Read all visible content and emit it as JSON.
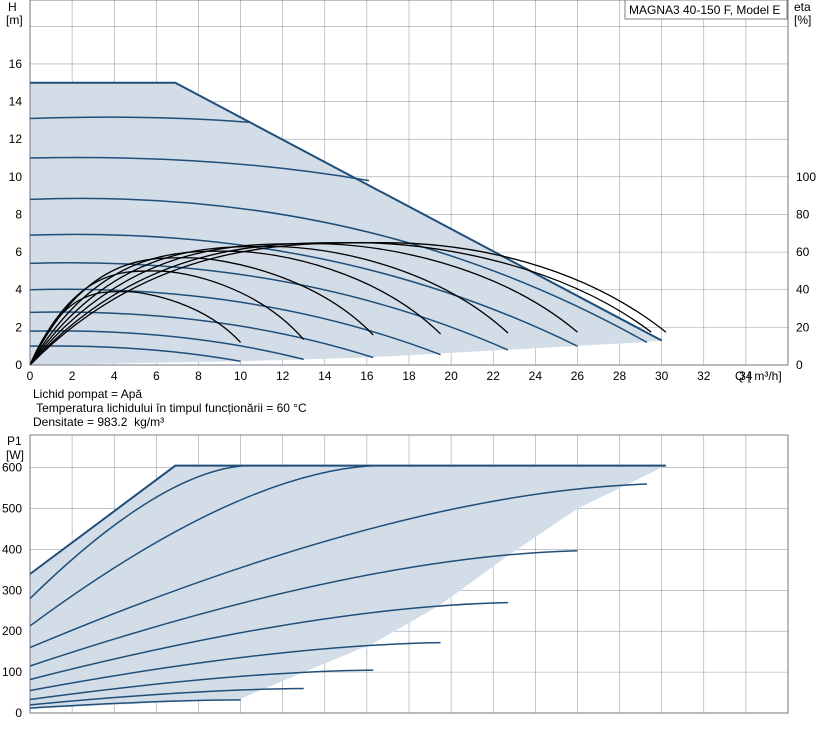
{
  "chart_data": [
    {
      "id": "hq",
      "type": "line",
      "title": "MAGNA3 40-150 F, Model E",
      "ylabel_line1": "H",
      "ylabel_line2": "[m]",
      "y2label_line1": "eta",
      "y2label_line2": "[%]",
      "xlabel": "Q [ m³/h]",
      "xlim": [
        0,
        36
      ],
      "ylim": [
        0,
        19.4
      ],
      "y2lim": [
        0,
        19.4
      ],
      "x_ticks": [
        0,
        2,
        4,
        6,
        8,
        10,
        12,
        14,
        16,
        18,
        20,
        22,
        24,
        26,
        28,
        30,
        32,
        34
      ],
      "y_ticks": [
        0,
        2,
        4,
        6,
        8,
        10,
        12,
        14,
        16
      ],
      "y2_ticks": [
        0,
        20,
        40,
        60,
        80,
        100
      ],
      "y2_scale_note": "eta 100% plotted at H=10 m",
      "grid": true,
      "notes": [
        "Lichid pompat = Apă",
        " Temperatura lichidului în timpul funcționării = 60 °C",
        "Densitate = 983.2  kg/m³"
      ],
      "operating_area_color": "#d3dde8",
      "curve_color": "#1f4e79",
      "eff_color": "#000000",
      "envelope": [
        [
          0,
          15
        ],
        [
          6.9,
          15
        ],
        [
          30,
          1.3
        ],
        [
          29,
          1.2
        ],
        [
          16,
          0.4
        ],
        [
          10,
          0.2
        ],
        [
          0,
          0
        ]
      ],
      "series": [
        {
          "values": [
            [
              0,
              1.0
            ],
            [
              10,
              0.2
            ]
          ]
        },
        {
          "values": [
            [
              0,
              1.8
            ],
            [
              13,
              0.3
            ]
          ]
        },
        {
          "values": [
            [
              0,
              2.8
            ],
            [
              16.3,
              0.4
            ]
          ]
        },
        {
          "values": [
            [
              0,
              4.0
            ],
            [
              19.5,
              0.55
            ]
          ]
        },
        {
          "values": [
            [
              0,
              5.4
            ],
            [
              22.7,
              0.8
            ]
          ]
        },
        {
          "values": [
            [
              0,
              6.9
            ],
            [
              26,
              1.0
            ]
          ]
        },
        {
          "values": [
            [
              0,
              8.8
            ],
            [
              29.3,
              1.2
            ]
          ]
        },
        {
          "values": [
            [
              0,
              11.0
            ],
            [
              16.1,
              9.8
            ]
          ]
        },
        {
          "values": [
            [
              0,
              13.1
            ],
            [
              10.4,
              12.9
            ]
          ]
        }
      ],
      "efficiency_series": [
        {
          "values": [
            [
              0,
              0
            ],
            [
              4.5,
              3.9
            ],
            [
              10,
              1.2
            ]
          ]
        },
        {
          "values": [
            [
              0,
              0
            ],
            [
              6,
              5.0
            ],
            [
              13,
              1.35
            ]
          ]
        },
        {
          "values": [
            [
              0,
              0
            ],
            [
              7.5,
              5.7
            ],
            [
              16.3,
              1.6
            ]
          ]
        },
        {
          "values": [
            [
              0,
              0
            ],
            [
              9.5,
              6.05
            ],
            [
              19.5,
              1.65
            ]
          ]
        },
        {
          "values": [
            [
              0,
              0
            ],
            [
              11.5,
              6.3
            ],
            [
              22.7,
              1.7
            ]
          ]
        },
        {
          "values": [
            [
              0,
              0
            ],
            [
              13.5,
              6.45
            ],
            [
              26,
              1.75
            ]
          ]
        },
        {
          "values": [
            [
              0,
              0
            ],
            [
              15.5,
              6.5
            ],
            [
              29.5,
              1.75
            ]
          ]
        },
        {
          "values": [
            [
              0,
              0
            ],
            [
              16.8,
              6.5
            ],
            [
              30.2,
              1.75
            ]
          ]
        }
      ]
    },
    {
      "id": "p1",
      "type": "line",
      "ylabel_line1": "P1",
      "ylabel_line2": "[W]",
      "xlim": [
        0,
        36
      ],
      "ylim": [
        0,
        680
      ],
      "y_ticks": [
        0,
        100,
        200,
        300,
        400,
        500,
        600
      ],
      "grid": true,
      "operating_area_color": "#d3dde8",
      "curve_color": "#1f4e79",
      "envelope": [
        [
          0,
          340
        ],
        [
          6.9,
          605
        ],
        [
          30.2,
          605
        ],
        [
          26,
          500
        ],
        [
          22.7,
          385
        ],
        [
          19.5,
          265
        ],
        [
          16.3,
          170
        ],
        [
          13,
          100
        ],
        [
          10,
          35
        ],
        [
          0,
          10
        ]
      ],
      "series": [
        {
          "values": [
            [
              0,
              12
            ],
            [
              10,
              32
            ]
          ]
        },
        {
          "values": [
            [
              0,
              20
            ],
            [
              13,
              60
            ]
          ]
        },
        {
          "values": [
            [
              0,
              33
            ],
            [
              16.3,
              105
            ]
          ]
        },
        {
          "values": [
            [
              0,
              55
            ],
            [
              19.5,
              172
            ]
          ]
        },
        {
          "values": [
            [
              0,
              82
            ],
            [
              22.7,
              270
            ]
          ]
        },
        {
          "values": [
            [
              0,
              115
            ],
            [
              26,
              397
            ]
          ]
        },
        {
          "values": [
            [
              0,
              160
            ],
            [
              29.3,
              560
            ]
          ]
        },
        {
          "values": [
            [
              0,
              213
            ],
            [
              16.3,
              605
            ]
          ]
        },
        {
          "values": [
            [
              0,
              280
            ],
            [
              10.2,
              605
            ]
          ]
        },
        {
          "values": [
            [
              0,
              340
            ],
            [
              6.9,
              605
            ],
            [
              30.2,
              605
            ]
          ]
        }
      ]
    }
  ]
}
